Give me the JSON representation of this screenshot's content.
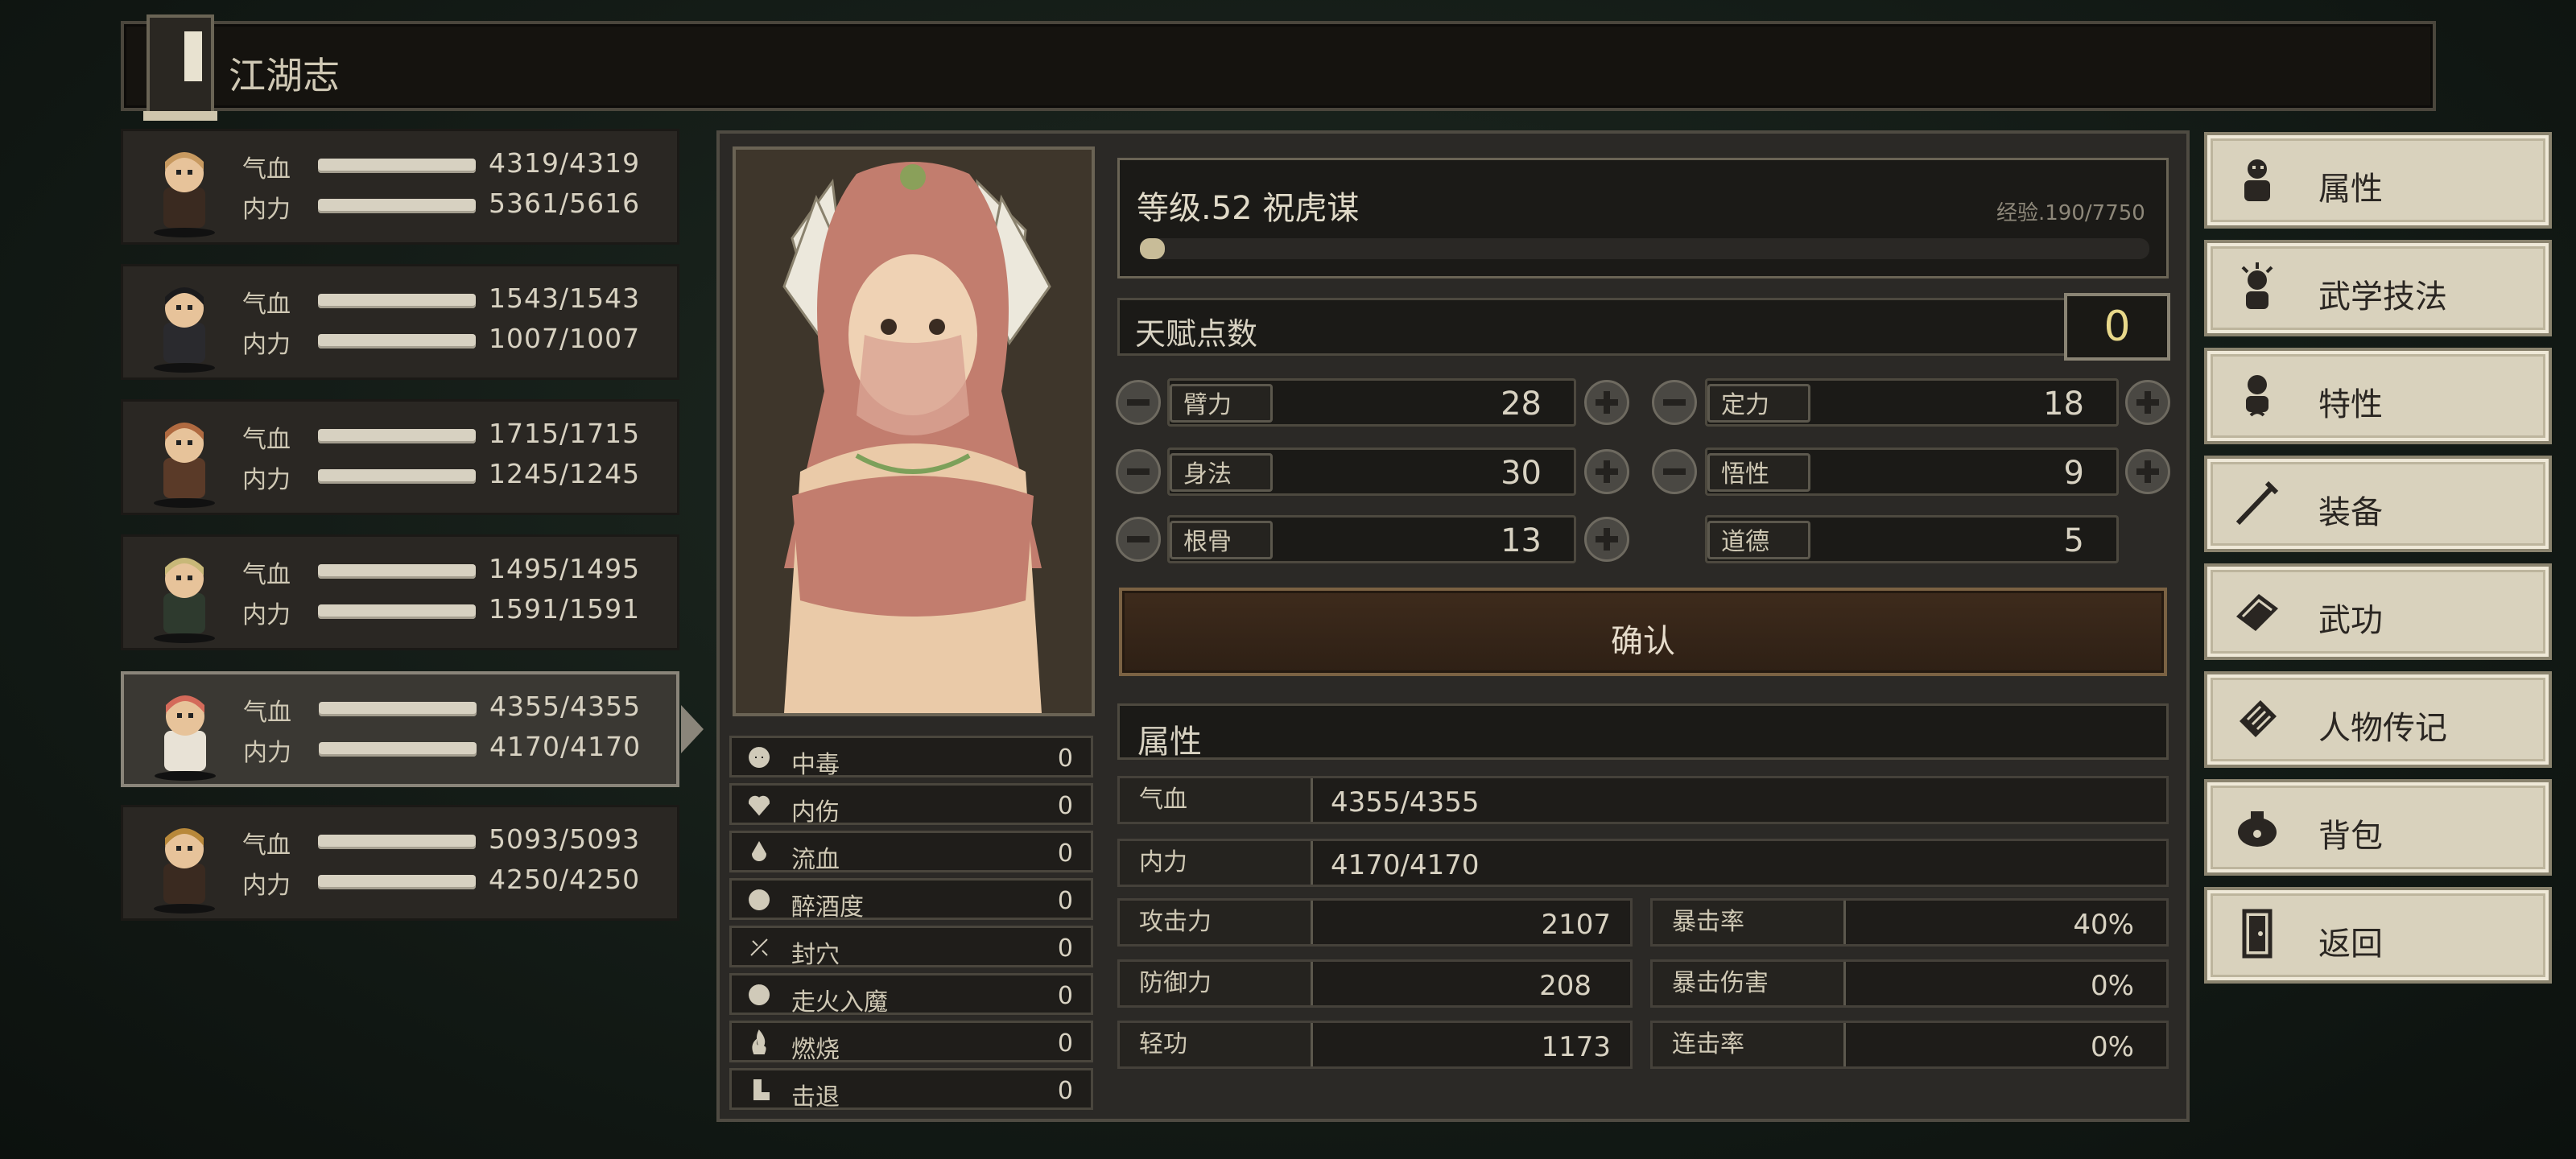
{
  "title": "江湖志",
  "party": [
    {
      "hp_label": "气血",
      "hp": "4319/4319",
      "mp_label": "内力",
      "mp": "5361/5616",
      "selected": false
    },
    {
      "hp_label": "气血",
      "hp": "1543/1543",
      "mp_label": "内力",
      "mp": "1007/1007",
      "selected": false
    },
    {
      "hp_label": "气血",
      "hp": "1715/1715",
      "mp_label": "内力",
      "mp": "1245/1245",
      "selected": false
    },
    {
      "hp_label": "气血",
      "hp": "1495/1495",
      "mp_label": "内力",
      "mp": "1591/1591",
      "selected": false
    },
    {
      "hp_label": "气血",
      "hp": "4355/4355",
      "mp_label": "内力",
      "mp": "4170/4170",
      "selected": true
    },
    {
      "hp_label": "气血",
      "hp": "5093/5093",
      "mp_label": "内力",
      "mp": "4250/4250",
      "selected": false
    }
  ],
  "character": {
    "level_line": "等级.52  祝虎谋",
    "exp_text": "经验.190/7750",
    "exp_fraction": 0.0245
  },
  "talent": {
    "label": "天赋点数",
    "value": "0"
  },
  "attributes": {
    "arm": {
      "label": "臂力",
      "value": "28"
    },
    "focus": {
      "label": "定力",
      "value": "18"
    },
    "agility": {
      "label": "身法",
      "value": "30"
    },
    "insight": {
      "label": "悟性",
      "value": "9"
    },
    "bone": {
      "label": "根骨",
      "value": "13"
    },
    "morality": {
      "label": "道德",
      "value": "5"
    }
  },
  "confirm_label": "确认",
  "status_effects": [
    {
      "name": "中毒",
      "value": "0",
      "icon": "skull-icon"
    },
    {
      "name": "内伤",
      "value": "0",
      "icon": "broken-heart-icon"
    },
    {
      "name": "流血",
      "value": "0",
      "icon": "blood-drop-icon"
    },
    {
      "name": "醉酒度",
      "value": "0",
      "icon": "drunk-face-icon"
    },
    {
      "name": "封穴",
      "value": "0",
      "icon": "acupoint-icon"
    },
    {
      "name": "走火入魔",
      "value": "0",
      "icon": "demon-icon"
    },
    {
      "name": "燃烧",
      "value": "0",
      "icon": "flame-icon"
    },
    {
      "name": "击退",
      "value": "0",
      "icon": "boot-icon"
    }
  ],
  "stats": {
    "header": "属性",
    "hp": {
      "label": "气血",
      "value": "4355/4355"
    },
    "mp": {
      "label": "内力",
      "value": "4170/4170"
    },
    "attack": {
      "label": "攻击力",
      "value": "2107"
    },
    "defense": {
      "label": "防御力",
      "value": "208"
    },
    "lightness": {
      "label": "轻功",
      "value": "1173"
    },
    "crit_rate": {
      "label": "暴击率",
      "value": "40%"
    },
    "crit_dmg": {
      "label": "暴击伤害",
      "value": "0%"
    },
    "combo_rate": {
      "label": "连击率",
      "value": "0%"
    }
  },
  "menu": [
    {
      "label": "属性",
      "icon": "character-icon"
    },
    {
      "label": "武学技法",
      "icon": "martial-arts-icon"
    },
    {
      "label": "特性",
      "icon": "trait-icon"
    },
    {
      "label": "装备",
      "icon": "sword-icon"
    },
    {
      "label": "武功",
      "icon": "book-icon"
    },
    {
      "label": "人物传记",
      "icon": "scroll-icon"
    },
    {
      "label": "背包",
      "icon": "bag-icon"
    },
    {
      "label": "返回",
      "icon": "door-icon"
    }
  ]
}
